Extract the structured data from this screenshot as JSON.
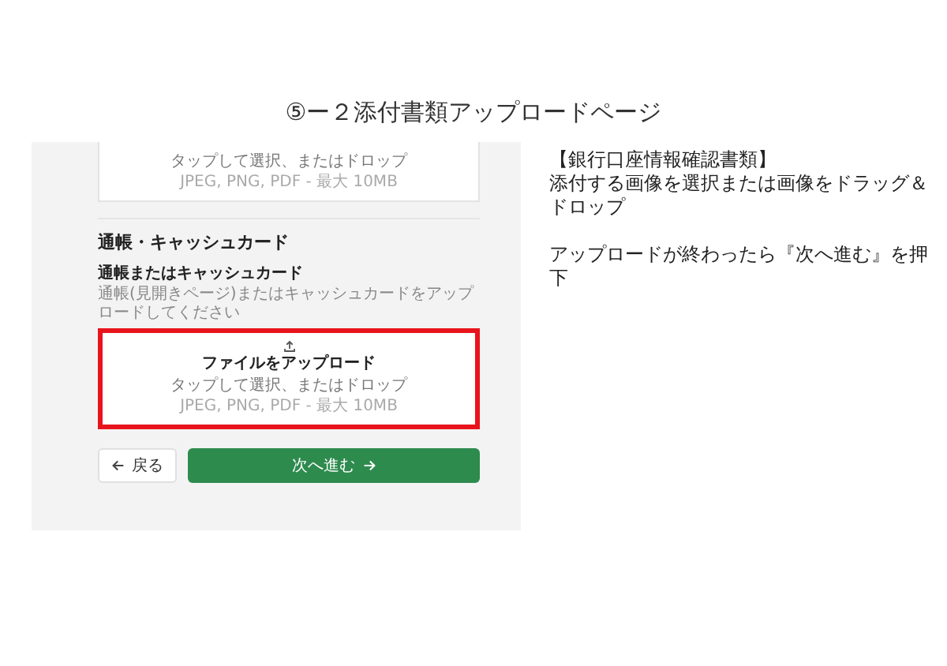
{
  "slide": {
    "title": "⑤ー２添付書類アップロードページ"
  },
  "screenshot": {
    "previous_upload": {
      "hint": "タップして選択、またはドロップ",
      "formats": "JPEG, PNG, PDF - 最大 10MB"
    },
    "section_title": "通帳・キャッシュカード",
    "field": {
      "label": "通帳またはキャッシュカード",
      "help": "通帳(見開きページ)またはキャッシュカードをアップロードしてください",
      "upload_title": "ファイルをアップロード",
      "hint": "タップして選択、またはドロップ",
      "formats": "JPEG, PNG, PDF - 最大 10MB",
      "highlighted": true
    },
    "buttons": [
      {
        "kind": "back",
        "label": "戻る"
      },
      {
        "kind": "next",
        "label": "次へ進む"
      }
    ]
  },
  "notes": {
    "heading": "【銀行口座情報確認書類】",
    "paragraphs": [
      "添付する画像を選択または画像をドラッグ＆ドロップ",
      "アップロードが終わったら『次へ進む』を押下"
    ]
  }
}
